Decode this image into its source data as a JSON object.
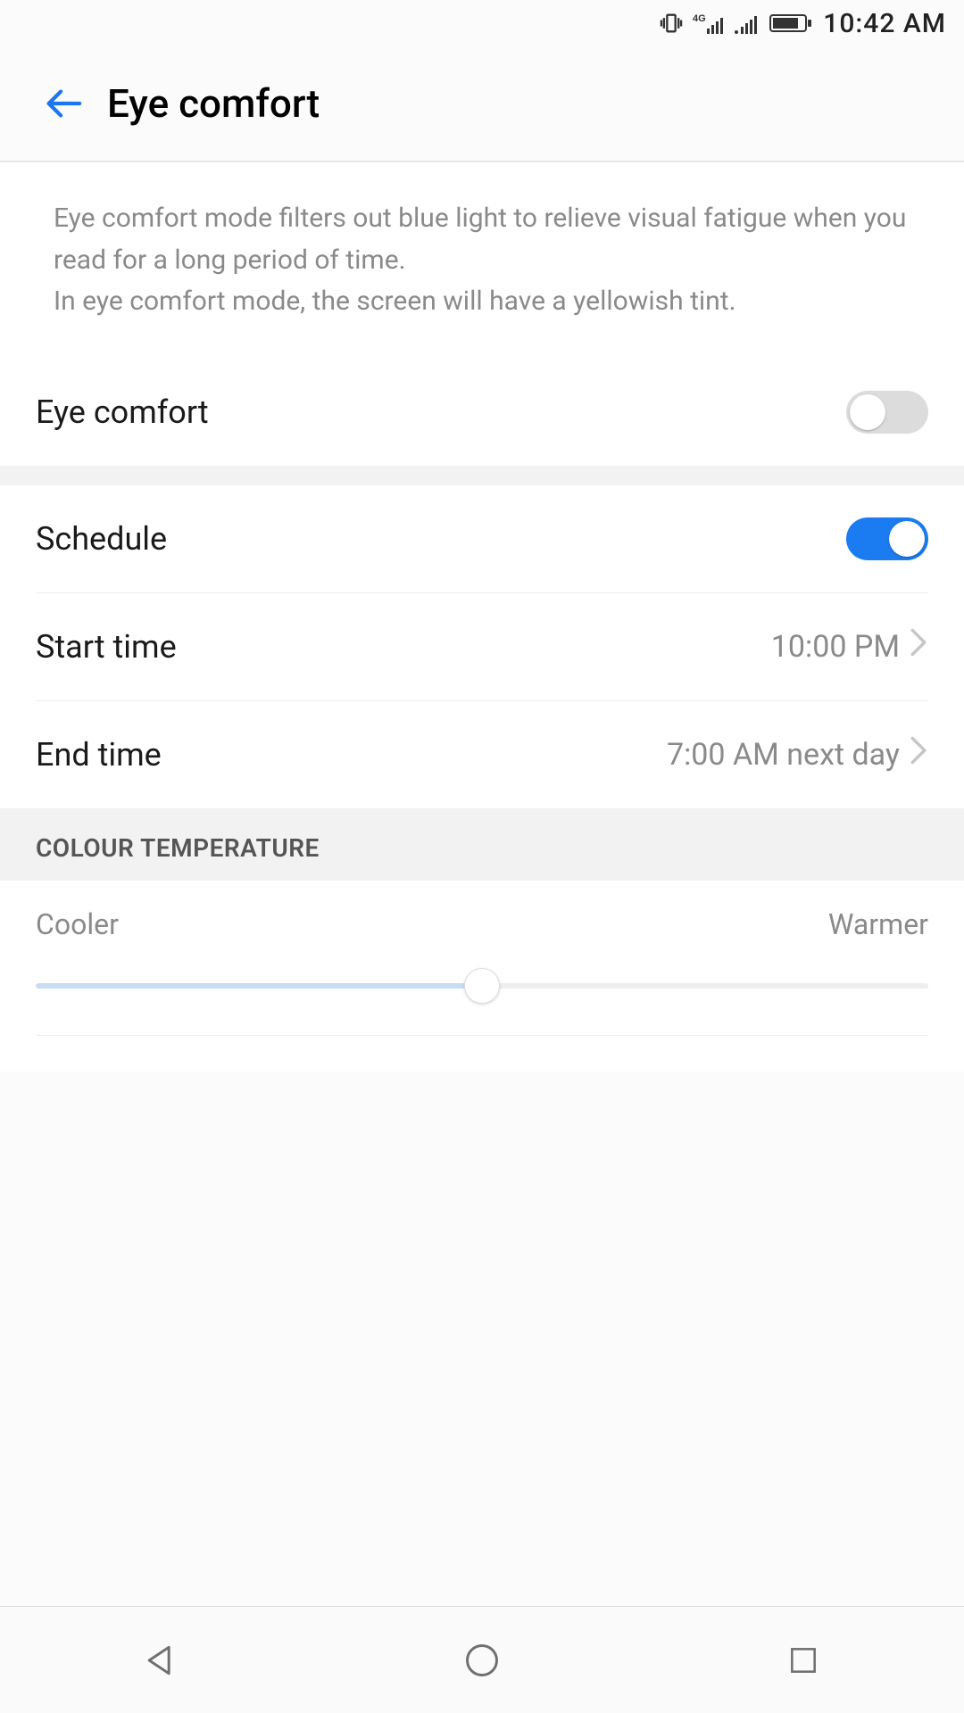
{
  "status_bar": {
    "time": "10:42 AM"
  },
  "appbar": {
    "title": "Eye comfort"
  },
  "description": "Eye comfort mode filters out blue light to relieve visual fatigue when you read for a long period of time.\nIn eye comfort mode, the screen will have a yellowish tint.",
  "settings": {
    "eye_comfort": {
      "label": "Eye comfort",
      "enabled": false
    },
    "schedule": {
      "label": "Schedule",
      "enabled": true
    },
    "start_time": {
      "label": "Start time",
      "value": "10:00 PM"
    },
    "end_time": {
      "label": "End time",
      "value": "7:00 AM next day"
    }
  },
  "colour_temperature": {
    "header": "COLOUR TEMPERATURE",
    "min_label": "Cooler",
    "max_label": "Warmer",
    "value_percent": 50
  }
}
